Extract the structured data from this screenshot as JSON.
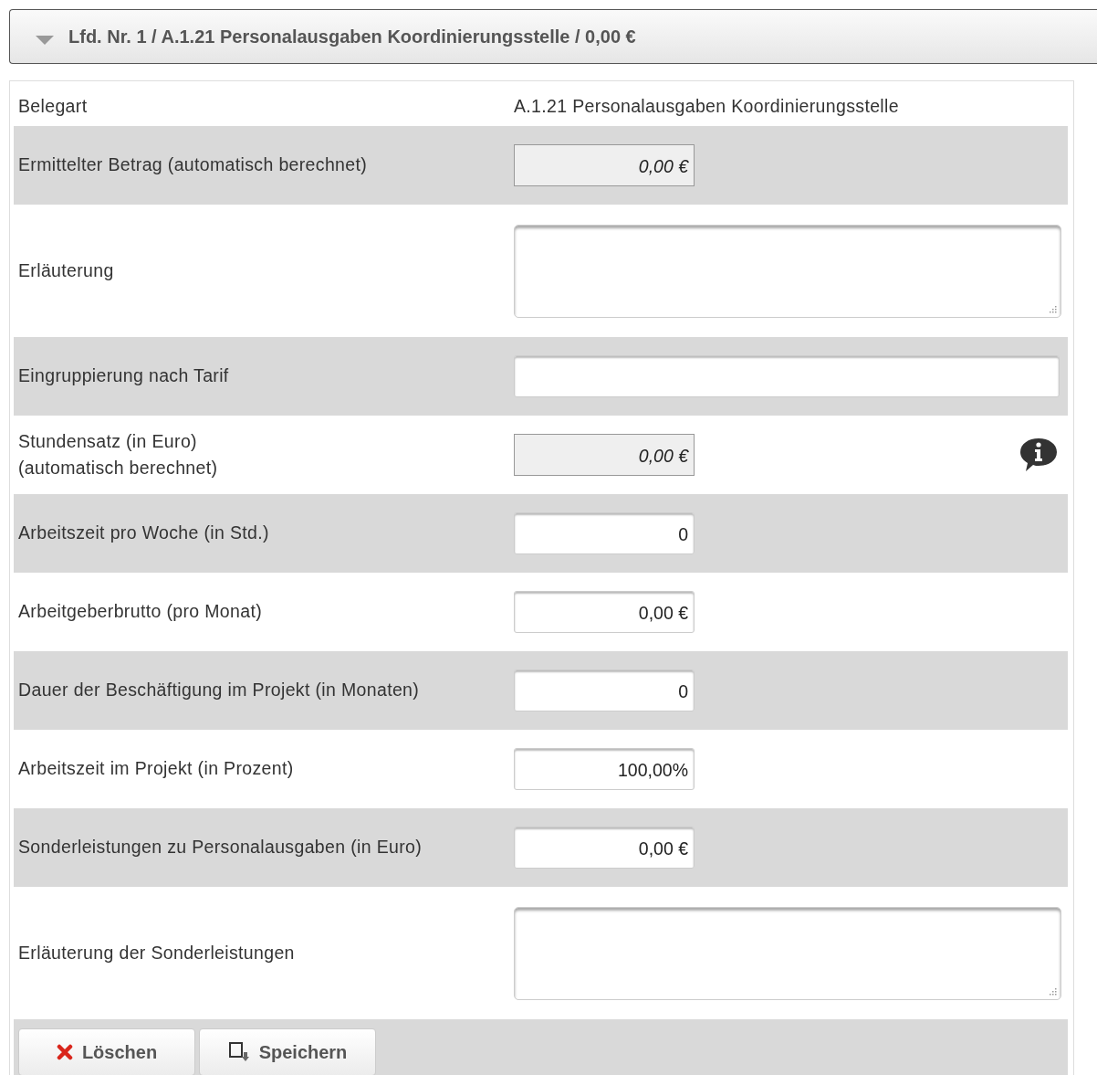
{
  "header": {
    "title": "Lfd. Nr. 1 / A.1.21 Personalausgaben Koordinierungsstelle / 0,00 €",
    "expanded": true
  },
  "rows": [
    {
      "kind": "text",
      "label": "Belegart",
      "value": "A.1.21 Personalausgaben Koordinierungsstelle"
    },
    {
      "kind": "readonly",
      "label": "Ermittelter Betrag (automatisch berechnet)",
      "value": "0,00 €"
    },
    {
      "kind": "textarea",
      "label": "Erläuterung"
    },
    {
      "kind": "wide",
      "label": "Eingruppierung nach Tarif"
    },
    {
      "kind": "readonly",
      "label": "Stundensatz (in Euro)\n(automatisch berechnet)",
      "value": "0,00 €",
      "info": true
    },
    {
      "kind": "input",
      "label": "Arbeitszeit pro Woche (in Std.)",
      "value": "0"
    },
    {
      "kind": "input",
      "label": "Arbeitgeberbrutto (pro Monat)",
      "value": "0,00 €"
    },
    {
      "kind": "input",
      "label": "Dauer der Beschäftigung im Projekt (in Monaten)",
      "value": "0"
    },
    {
      "kind": "input",
      "label": "Arbeitszeit im Projekt (in Prozent)",
      "value": "100,00%"
    },
    {
      "kind": "input",
      "label": "Sonderleistungen zu Personalausgaben (in Euro)",
      "value": "0,00 €"
    },
    {
      "kind": "textarea",
      "label": "Erläuterung der Sonderleistungen"
    }
  ],
  "buttons": [
    {
      "kind": "delete",
      "label": "Löschen"
    },
    {
      "kind": "save",
      "label": "Speichern"
    }
  ]
}
